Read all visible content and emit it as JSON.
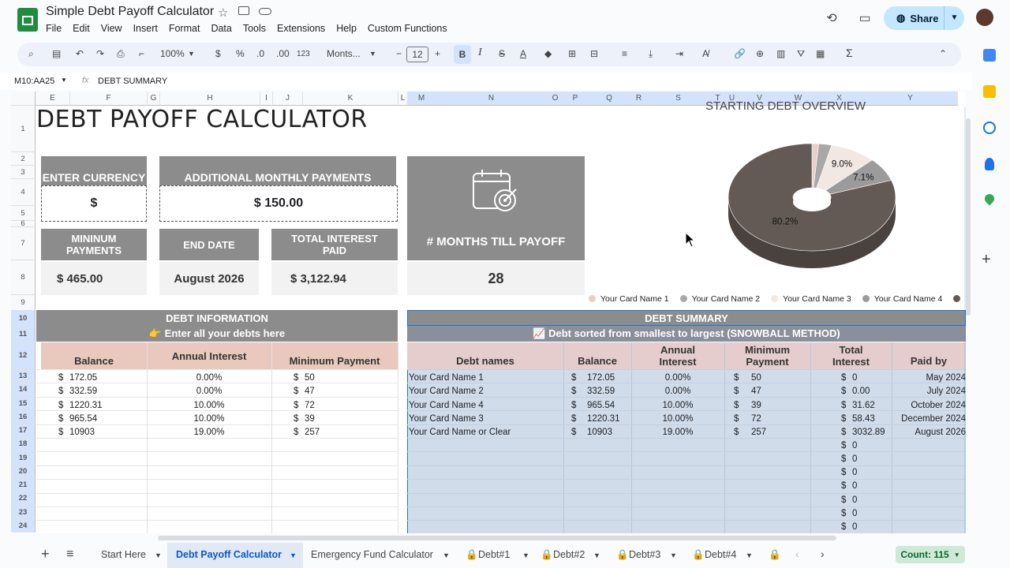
{
  "doc": {
    "title": "Simple Debt Payoff Calculator"
  },
  "menu": [
    "File",
    "Edit",
    "View",
    "Insert",
    "Format",
    "Data",
    "Tools",
    "Extensions",
    "Help",
    "Custom Functions"
  ],
  "share_label": "Share",
  "toolbar": {
    "zoom": "100%",
    "currency": "$",
    "percent": "%",
    "dec_less": ".0",
    "dec_more": ".00",
    "num_fmt": "123",
    "font": "Monts...",
    "font_size": "12",
    "bold": "B",
    "italic": "I",
    "strike": "S",
    "textcolor": "A",
    "sum": "Σ"
  },
  "formula": {
    "cell_ref": "M10:AA25",
    "fx": "fx",
    "content": "DEBT SUMMARY"
  },
  "columns": [
    {
      "l": "E",
      "w": 44
    },
    {
      "l": "F",
      "w": 98
    },
    {
      "l": "G",
      "w": 16
    },
    {
      "l": "H",
      "w": 127
    },
    {
      "l": "I",
      "w": 16
    },
    {
      "l": "J",
      "w": 38
    },
    {
      "l": "K",
      "w": 121
    },
    {
      "l": "L",
      "w": 12
    },
    {
      "l": "M",
      "w": 35
    },
    {
      "l": "N",
      "w": 142
    },
    {
      "l": "O",
      "w": 20
    },
    {
      "l": "P",
      "w": 31
    },
    {
      "l": "Q",
      "w": 55
    },
    {
      "l": "R",
      "w": 20
    },
    {
      "l": "S",
      "w": 80
    },
    {
      "l": "T",
      "w": 20
    },
    {
      "l": "U",
      "w": 16
    },
    {
      "l": "V",
      "w": 54
    },
    {
      "l": "W",
      "w": 44
    },
    {
      "l": "X",
      "w": 60
    },
    {
      "l": "Y",
      "w": 120
    }
  ],
  "rows": [
    "1",
    "2",
    "3",
    "4",
    "5",
    "6",
    "7",
    "8",
    "9",
    "10",
    "11",
    "12",
    "13",
    "14",
    "15",
    "16",
    "17",
    "18",
    "19",
    "20",
    "21",
    "22",
    "23",
    "24"
  ],
  "sheet": {
    "main_title": "DEBT PAYOFF CALCULATOR",
    "currency_label": "ENTER CURRENCY",
    "currency_value": "$",
    "additional_label": "ADDITIONAL MONTHLY PAYMENTS",
    "additional_value": "$ 150.00",
    "min_label": "MININUM PAYMENTS",
    "min_value": "$ 465.00",
    "end_label": "END DATE",
    "end_value": "August 2026",
    "interest_label": "TOTAL INTEREST PAID",
    "interest_value": "$ 3,122.94",
    "months_label": "# MONTHS TILL PAYOFF",
    "months_value": "28",
    "debt_info": "DEBT INFORMATION",
    "debt_info_sub": "👉 Enter all your debts here",
    "info_headers": [
      "Balance",
      "Annual Interest",
      "Minimum Payment"
    ],
    "info_rows": [
      [
        "$",
        "172.05",
        "0.00%",
        "$",
        "50"
      ],
      [
        "$",
        "332.59",
        "0.00%",
        "$",
        "47"
      ],
      [
        "$",
        "1220.31",
        "10.00%",
        "$",
        "72"
      ],
      [
        "$",
        "965.54",
        "10.00%",
        "$",
        "39"
      ],
      [
        "$",
        "10903",
        "19.00%",
        "$",
        "257"
      ]
    ],
    "summary_title": "DEBT SUMMARY",
    "summary_sub": "📈 Debt sorted from smallest to largest (SNOWBALL METHOD)",
    "summary_headers": [
      "Debt names",
      "Balance",
      "Annual Interest",
      "Minimum Payment",
      "Total Interest",
      "Paid by"
    ],
    "summary_rows": [
      [
        "Your Card Name 1",
        "$",
        "172.05",
        "0.00%",
        "$",
        "50",
        "$",
        "0",
        "May 2024"
      ],
      [
        "Your Card Name 2",
        "$",
        "332.59",
        "0.00%",
        "$",
        "47",
        "$",
        "0.00",
        "July 2024"
      ],
      [
        "Your Card Name 4",
        "$",
        "965.54",
        "10.00%",
        "$",
        "39",
        "$",
        "31.62",
        "October 2024"
      ],
      [
        "Your Card Name 3",
        "$",
        "1220.31",
        "10.00%",
        "$",
        "72",
        "$",
        "58.43",
        "December 2024"
      ],
      [
        "Your Card Name or Clear",
        "$",
        "10903",
        "19.00%",
        "$",
        "257",
        "$",
        "3032.89",
        "August 2026"
      ]
    ],
    "empty_interest": [
      "$",
      "0"
    ]
  },
  "chart_data": {
    "type": "pie",
    "title": "STARTING DEBT OVERVIEW",
    "categories": [
      "Your Card Name 1",
      "Your Card Name 2",
      "Your Card Name 3",
      "Your Card Name 4",
      "Your Card Name or Clear"
    ],
    "values": [
      1.3,
      2.5,
      9.0,
      7.1,
      80.2
    ],
    "labels": [
      "",
      "",
      "9.0%",
      "7.1%",
      "80.2%"
    ],
    "colors": [
      "#e8cfc8",
      "#a8a8a8",
      "#f1e8e4",
      "#9b9b9b",
      "#645a55"
    ],
    "legend_position": "bottom",
    "legend_visible": [
      "Your Card Name 1",
      "Your Card Name 2",
      "Your Card Name 3",
      "Your Card Name 4",
      "Your"
    ]
  },
  "tabs": [
    "Start Here",
    "Debt Payoff Calculator",
    "Emergency Fund Calculator",
    "Debt#1",
    "Debt#2",
    "Debt#3",
    "Debt#4"
  ],
  "status": {
    "count": "Count: 115"
  }
}
